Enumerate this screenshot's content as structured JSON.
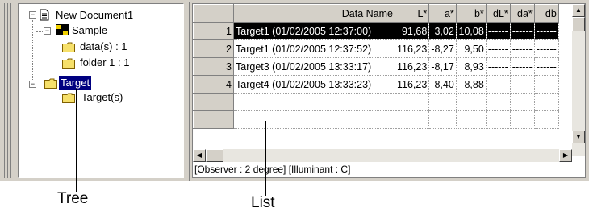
{
  "tree": {
    "root": {
      "label": "New Document1",
      "icon": "document-icon"
    },
    "sample": {
      "label": "Sample",
      "icon": "color-swatch-icon"
    },
    "sample_children": [
      {
        "label": "data(s) : 1",
        "icon": "folder-icon"
      },
      {
        "label": "folder 1 : 1",
        "icon": "folder-icon"
      }
    ],
    "target": {
      "label": "Target",
      "icon": "folder-icon",
      "selected": true
    },
    "target_children": [
      {
        "label": "Target(s)",
        "icon": "folder-icon"
      }
    ]
  },
  "list": {
    "columns": [
      "",
      "Data Name",
      "L*",
      "a*",
      "b*",
      "dL*",
      "da*",
      "db"
    ],
    "rows": [
      {
        "num": "1",
        "name": "Target1 (01/02/2005 12:37:00)",
        "L": "91,68",
        "a": "3,02",
        "b": "10,08",
        "dL": "------",
        "da": "------",
        "db": "------",
        "selected": true
      },
      {
        "num": "2",
        "name": "Target1 (01/02/2005 12:37:52)",
        "L": "116,23",
        "a": "-8,27",
        "b": "9,50",
        "dL": "------",
        "da": "------",
        "db": "------"
      },
      {
        "num": "3",
        "name": "Target3 (01/02/2005 13:33:17)",
        "L": "116,23",
        "a": "-8,17",
        "b": "8,93",
        "dL": "------",
        "da": "------",
        "db": "------"
      },
      {
        "num": "4",
        "name": "Target4 (01/02/2005 13:33:23)",
        "L": "116,23",
        "a": "-8,40",
        "b": "8,88",
        "dL": "------",
        "da": "------",
        "db": "------"
      }
    ],
    "status": "[Observer : 2 degree]  [Illuminant : C]"
  },
  "callouts": {
    "tree": "Tree",
    "list": "List"
  },
  "colors": {
    "selection": "#000080",
    "row_selection": "#000000",
    "chrome": "#d4d0c8"
  }
}
